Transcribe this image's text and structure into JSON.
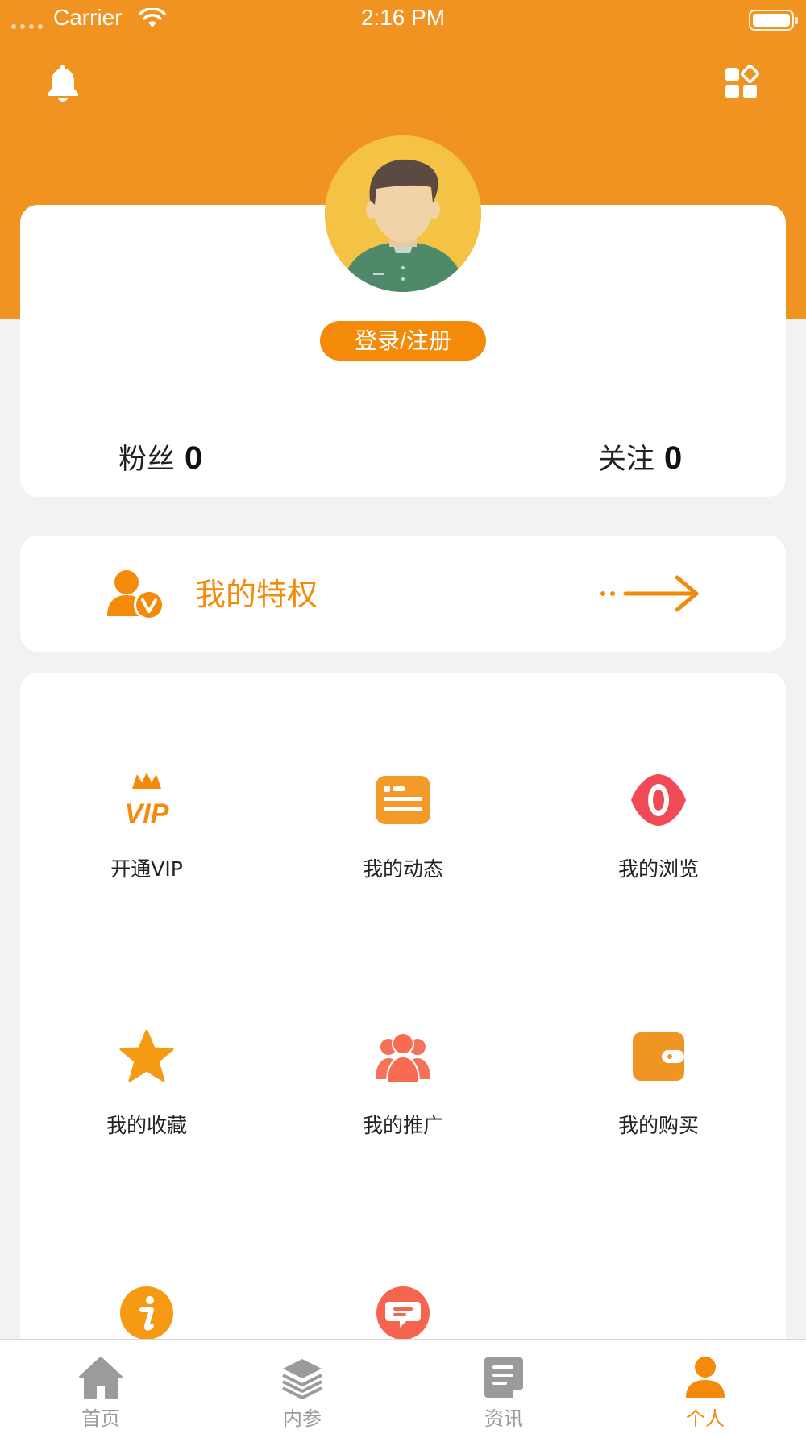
{
  "status_bar": {
    "carrier": "Carrier",
    "time": "2:16 PM"
  },
  "header": {
    "left_icon": "bell-icon",
    "right_icon": "apps-grid-icon"
  },
  "profile": {
    "login_label": "登录/注册",
    "fans_label": "粉丝",
    "fans_count": "0",
    "follow_label": "关注",
    "follow_count": "0"
  },
  "privilege": {
    "label": "我的特权",
    "icon": "user-vip-icon"
  },
  "grid": [
    {
      "label": "开通VIP",
      "icon": "vip-crown-icon"
    },
    {
      "label": "我的动态",
      "icon": "news-card-icon"
    },
    {
      "label": "我的浏览",
      "icon": "eye-icon"
    },
    {
      "label": "我的收藏",
      "icon": "star-icon"
    },
    {
      "label": "我的推广",
      "icon": "group-icon"
    },
    {
      "label": "我的购买",
      "icon": "wallet-icon"
    },
    {
      "label": "",
      "icon": "info-icon"
    },
    {
      "label": "",
      "icon": "message-icon"
    }
  ],
  "tabbar": [
    {
      "label": "首页",
      "icon": "home-icon",
      "active": false
    },
    {
      "label": "内参",
      "icon": "layers-icon",
      "active": false
    },
    {
      "label": "资讯",
      "icon": "document-icon",
      "active": false
    },
    {
      "label": "个人",
      "icon": "person-icon",
      "active": true
    }
  ],
  "colors": {
    "header": "#f09321",
    "accent": "#f38a0a",
    "background": "#f2f2f2",
    "tab_inactive": "#9b9b9b"
  }
}
